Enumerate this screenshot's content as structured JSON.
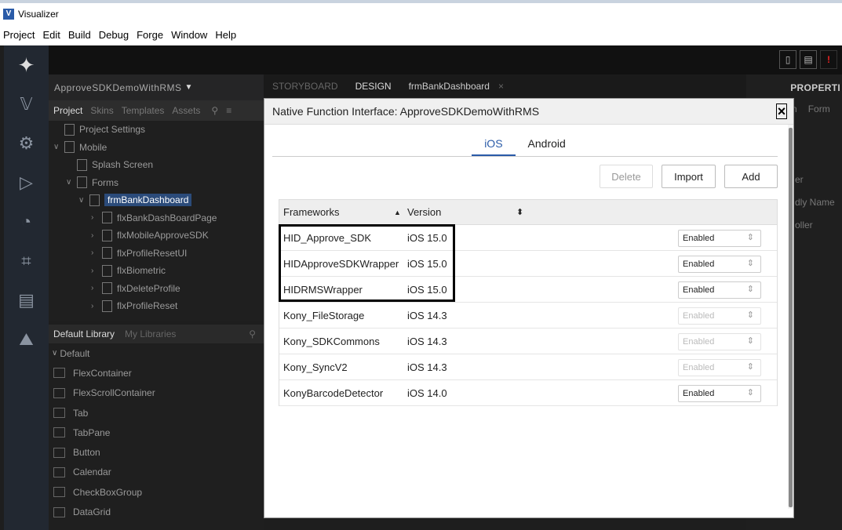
{
  "window": {
    "title": "Visualizer"
  },
  "menu": [
    "Project",
    "Edit",
    "Build",
    "Debug",
    "Forge",
    "Window",
    "Help"
  ],
  "project": {
    "name": "ApproveSDKDemoWithRMS",
    "tabs": [
      "Project",
      "Skins",
      "Templates",
      "Assets"
    ],
    "tree": [
      {
        "label": "Project Settings",
        "indent": 0,
        "caret": ""
      },
      {
        "label": "Mobile",
        "indent": 0,
        "caret": "∨"
      },
      {
        "label": "Splash Screen",
        "indent": 1,
        "caret": ""
      },
      {
        "label": "Forms",
        "indent": 1,
        "caret": "∨"
      },
      {
        "label": "frmBankDashboard",
        "indent": 2,
        "caret": "∨",
        "selected": true
      },
      {
        "label": "flxBankDashBoardPage",
        "indent": 3,
        "caret": "›"
      },
      {
        "label": "flxMobileApproveSDK",
        "indent": 3,
        "caret": "›"
      },
      {
        "label": "flxProfileResetUI",
        "indent": 3,
        "caret": "›"
      },
      {
        "label": "flxBiometric",
        "indent": 3,
        "caret": "›"
      },
      {
        "label": "flxDeleteProfile",
        "indent": 3,
        "caret": "›"
      },
      {
        "label": "flxProfileReset",
        "indent": 3,
        "caret": "›"
      }
    ]
  },
  "library": {
    "tabs": [
      "Default Library",
      "My Libraries"
    ],
    "group": "Default",
    "items": [
      "FlexContainer",
      "FlexScrollContainer",
      "Tab",
      "TabPane",
      "Button",
      "Calendar",
      "CheckBoxGroup",
      "DataGrid"
    ]
  },
  "center_tabs": [
    "STORYBOARD",
    "DESIGN",
    "frmBankDashboard"
  ],
  "right_panel": {
    "title": "PROPERTI",
    "tabs": [
      "n",
      "Form"
    ],
    "lines": [
      "er",
      "dly Name",
      "oller"
    ]
  },
  "dialog": {
    "title": "Native Function Interface: ApproveSDKDemoWithRMS",
    "os_tabs": [
      "iOS",
      "Android"
    ],
    "buttons": {
      "delete": "Delete",
      "import": "Import",
      "add": "Add"
    },
    "columns": {
      "frameworks": "Frameworks",
      "version": "Version"
    },
    "rows": [
      {
        "framework": "HID_Approve_SDK",
        "version": "iOS 15.0",
        "status": "Enabled",
        "disabled": false
      },
      {
        "framework": "HIDApproveSDKWrapper",
        "version": "iOS 15.0",
        "status": "Enabled",
        "disabled": false
      },
      {
        "framework": "HIDRMSWrapper",
        "version": "iOS 15.0",
        "status": "Enabled",
        "disabled": false
      },
      {
        "framework": "Kony_FileStorage",
        "version": "iOS 14.3",
        "status": "Enabled",
        "disabled": true
      },
      {
        "framework": "Kony_SDKCommons",
        "version": "iOS 14.3",
        "status": "Enabled",
        "disabled": true
      },
      {
        "framework": "Kony_SyncV2",
        "version": "iOS 14.3",
        "status": "Enabled",
        "disabled": true
      },
      {
        "framework": "KonyBarcodeDetector",
        "version": "iOS 14.0",
        "status": "Enabled",
        "disabled": false
      }
    ]
  }
}
